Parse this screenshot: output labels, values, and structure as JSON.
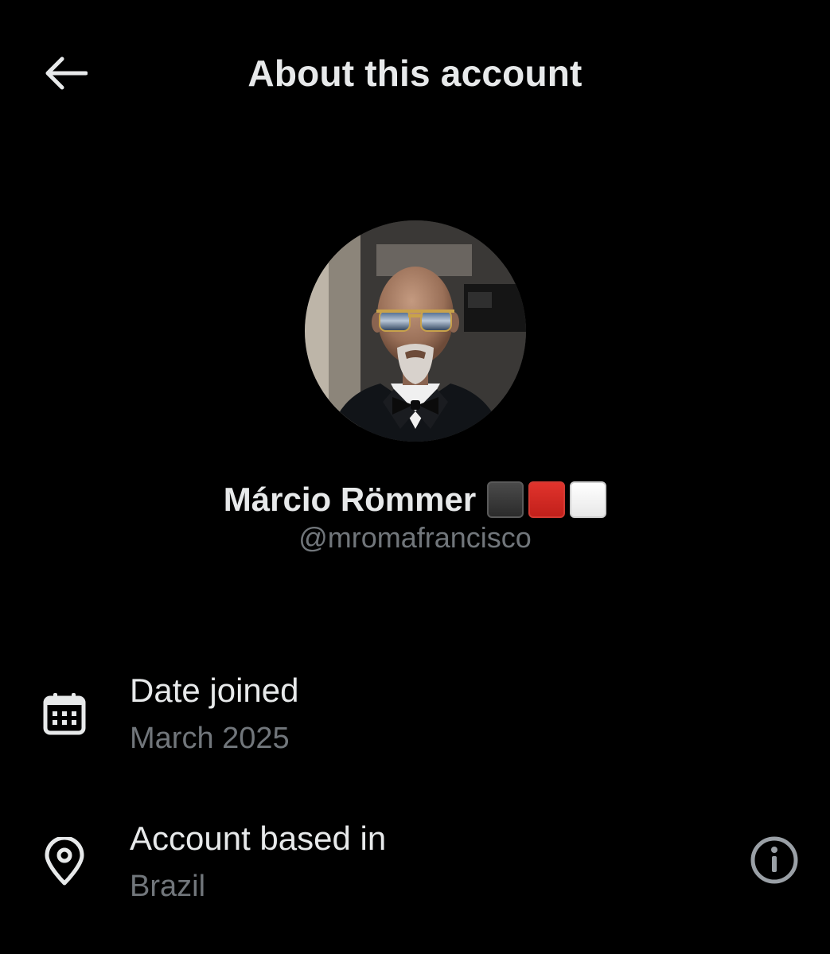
{
  "header": {
    "back_icon": "arrow-left-icon",
    "title": "About this account"
  },
  "profile": {
    "display_name": "Márcio Römmer",
    "name_badges": [
      {
        "name": "black-square",
        "color": "#3a3a3a"
      },
      {
        "name": "red-square",
        "color": "#d4261f"
      },
      {
        "name": "white-square",
        "color": "#f5f5f5"
      }
    ],
    "handle": "@mromafrancisco"
  },
  "details": [
    {
      "icon": "calendar-icon",
      "label": "Date joined",
      "value": "March 2025"
    },
    {
      "icon": "location-pin-icon",
      "label": "Account based in",
      "value": "Brazil",
      "action_icon": "info-icon"
    }
  ],
  "colors": {
    "background": "#000000",
    "primary_text": "#e7e9ea",
    "secondary_text": "#71767b"
  }
}
